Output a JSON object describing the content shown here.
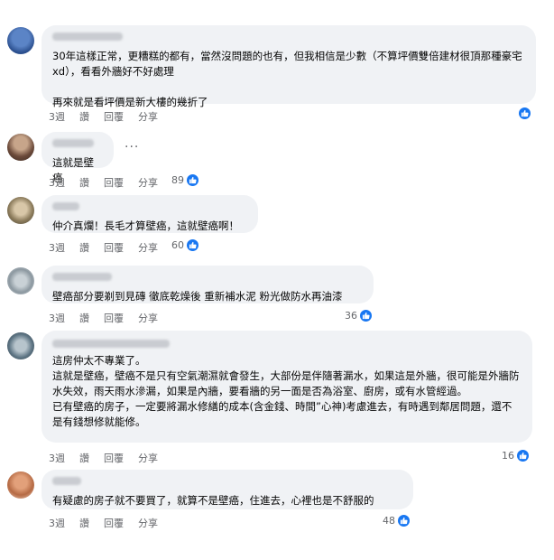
{
  "actions": {
    "time": "3週",
    "like": "讚",
    "reply": "回覆",
    "share": "分享"
  },
  "comments": [
    {
      "text": "30年這樣正常，更糟糕的都有，當然沒問題的也有，但我相信是少數（不算坪價雙倍建材很頂那種豪宅xd），看看外牆好不好處理\n\n再來就是看坪價是新大樓的幾折了",
      "likes": ""
    },
    {
      "text": "這就是壁癌",
      "likes": "89"
    },
    {
      "text": "仲介真爛！長毛才算壁癌，這就壁癌啊！",
      "likes": "60"
    },
    {
      "text": "壁癌部分要剃到見磚 徹底乾燥後 重新補水泥 粉光做防水再油漆",
      "likes": "36"
    },
    {
      "text": "這房仲太不專業了。\n這就是壁癌，壁癌不是只有空氣潮濕就會發生，大部份是伴隨著漏水，如果這是外牆，很可能是外牆防水失效，雨天雨水滲漏，如果是內牆，要看牆的另一面是否為浴室、廚房，或有水管經過。\n已有壁癌的房子，一定要將漏水修繕的成本(含金錢、時間”心神)考慮進去，有時遇到鄰居問題，還不是有錢想修就能修。",
      "likes": "16"
    },
    {
      "text": "有疑慮的房子就不要買了，就算不是壁癌，住進去，心裡也是不舒服的",
      "likes": "48"
    }
  ],
  "colors": {
    "bubble": "#f0f2f5",
    "like_blue": "#1877f2",
    "meta_gray": "#65676b"
  }
}
